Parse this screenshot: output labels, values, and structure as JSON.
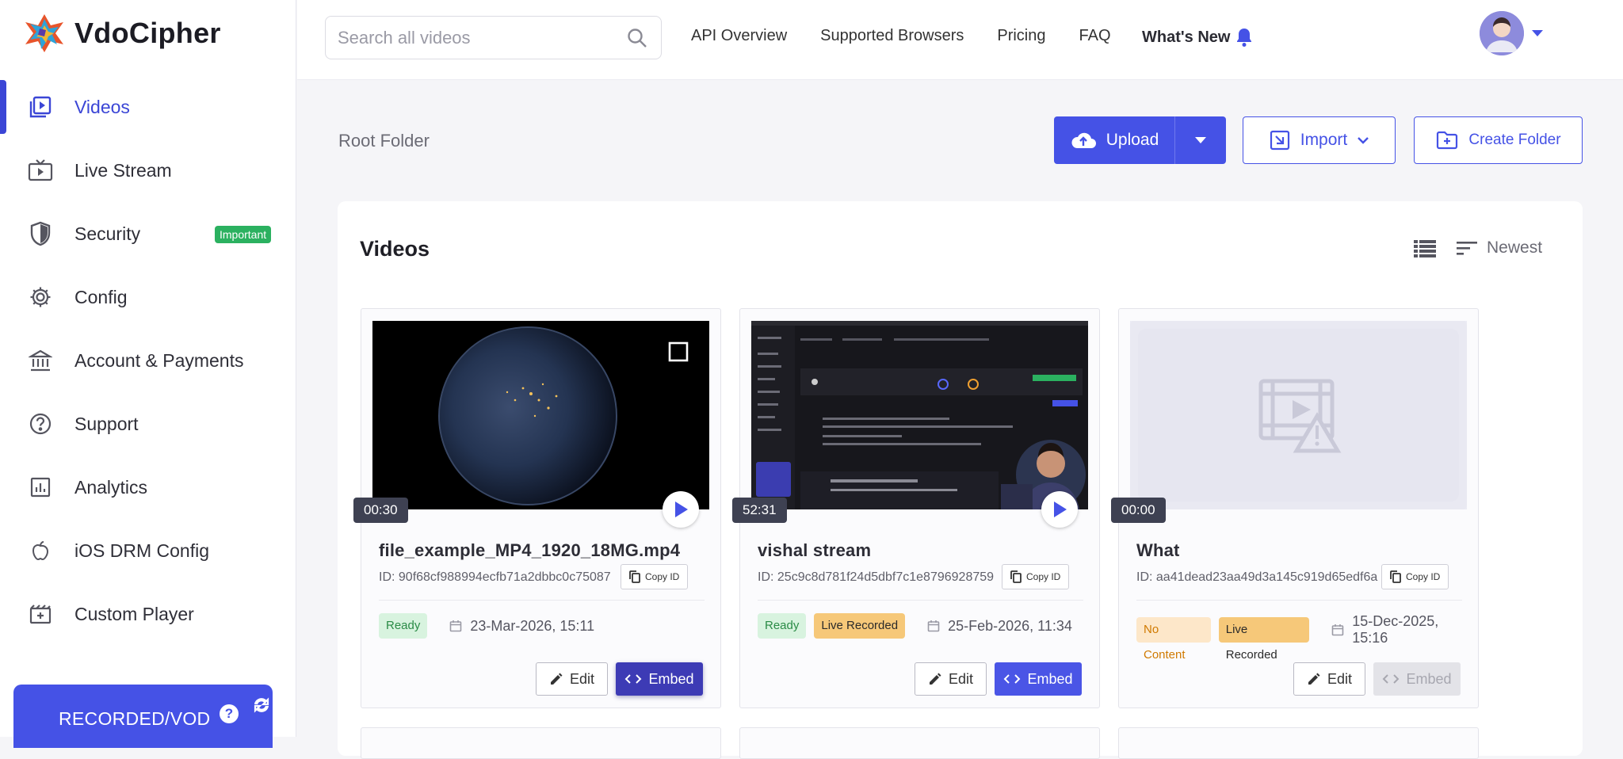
{
  "app": {
    "name": "VdoCipher"
  },
  "sidebar": {
    "items": [
      {
        "label": "Videos",
        "icon": "video-library-icon",
        "active": true
      },
      {
        "label": "Live Stream",
        "icon": "tv-icon"
      },
      {
        "label": "Security",
        "icon": "shield-icon",
        "badge": "Important"
      },
      {
        "label": "Config",
        "icon": "gear-icon"
      },
      {
        "label": "Account & Payments",
        "icon": "bank-icon"
      },
      {
        "label": "Support",
        "icon": "help-circle-icon"
      },
      {
        "label": "Analytics",
        "icon": "bar-chart-icon"
      },
      {
        "label": "iOS DRM Config",
        "icon": "apple-icon"
      },
      {
        "label": "Custom Player",
        "icon": "film-icon"
      }
    ],
    "plan": {
      "label": "RECORDED/VOD",
      "help": "?"
    }
  },
  "topbar": {
    "search_placeholder": "Search all videos",
    "links": [
      "API Overview",
      "Supported Browsers",
      "Pricing",
      "FAQ"
    ],
    "whats_new": "What's New"
  },
  "toolbar": {
    "breadcrumb": "Root Folder",
    "upload_label": "Upload",
    "import_label": "Import",
    "create_folder_label": "Create Folder"
  },
  "panel": {
    "title": "Videos",
    "sort_label": "Newest"
  },
  "videos": [
    {
      "duration": "00:30",
      "title": "file_example_MP4_1920_18MG.mp4",
      "id": "ID: 90f68cf988994ecfb71a2dbbc0c75087",
      "copy_label": "Copy ID",
      "status": "Ready",
      "tag2": "",
      "date": "23-Mar-2026, 15:11",
      "edit_label": "Edit",
      "embed_label": "Embed"
    },
    {
      "duration": "52:31",
      "title": "vishal stream",
      "id": "ID: 25c9c8d781f24d5dbf7c1e8796928759",
      "copy_label": "Copy ID",
      "status": "Ready",
      "tag2": "Live Recorded",
      "date": "25-Feb-2026, 11:34",
      "edit_label": "Edit",
      "embed_label": "Embed"
    },
    {
      "duration": "00:00",
      "title": "What",
      "id": "ID: aa41dead23aa49d3a145c919d65edf6a",
      "copy_label": "Copy ID",
      "status": "No Content",
      "tag2": "Live Recorded",
      "date": "15-Dec-2025, 15:16",
      "edit_label": "Edit",
      "embed_label": "Embed"
    }
  ],
  "colors": {
    "accent": "#4552e6",
    "ready": "#2a8b46",
    "live_recorded": "#f6c879",
    "important": "#2bb160"
  }
}
